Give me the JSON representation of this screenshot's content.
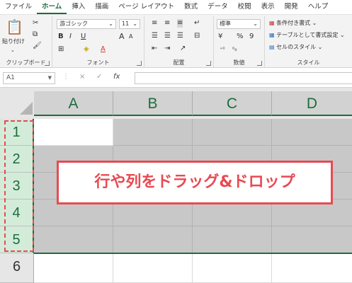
{
  "ribbon_tabs": [
    "ファイル",
    "ホーム",
    "挿入",
    "描画",
    "ページ レイアウト",
    "数式",
    "データ",
    "校閲",
    "表示",
    "開発",
    "ヘルプ"
  ],
  "active_tab": "ホーム",
  "clipboard": {
    "paste_label": "貼り付け",
    "group_label": "クリップボード"
  },
  "font": {
    "family": "游ゴシック",
    "size": "11",
    "group_label": "フォント",
    "bold": "B",
    "italic": "I",
    "underline": "U",
    "grow": "A",
    "shrink": "A"
  },
  "alignment": {
    "group_label": "配置"
  },
  "number": {
    "format": "標準",
    "group_label": "数値",
    "percent": "%",
    "comma": "9"
  },
  "styles": {
    "conditional": "条件付き書式",
    "table": "テーブルとして書式設定",
    "cell": "セルのスタイル",
    "group_label": "スタイル"
  },
  "formula_bar": {
    "name_box": "A1",
    "cancel": "×",
    "enter": "✓",
    "fx": "fx",
    "value": ""
  },
  "columns": [
    "A",
    "B",
    "C",
    "D"
  ],
  "rows": [
    "1",
    "2",
    "3",
    "4",
    "5",
    "6"
  ],
  "callout_text": "行や列をドラッグ&ドロップ",
  "colors": {
    "accent": "#1e6c3c",
    "highlight": "#e84a52",
    "selection_fill": "#c8c8c8",
    "row_header_selected": "#d3ecd9"
  }
}
